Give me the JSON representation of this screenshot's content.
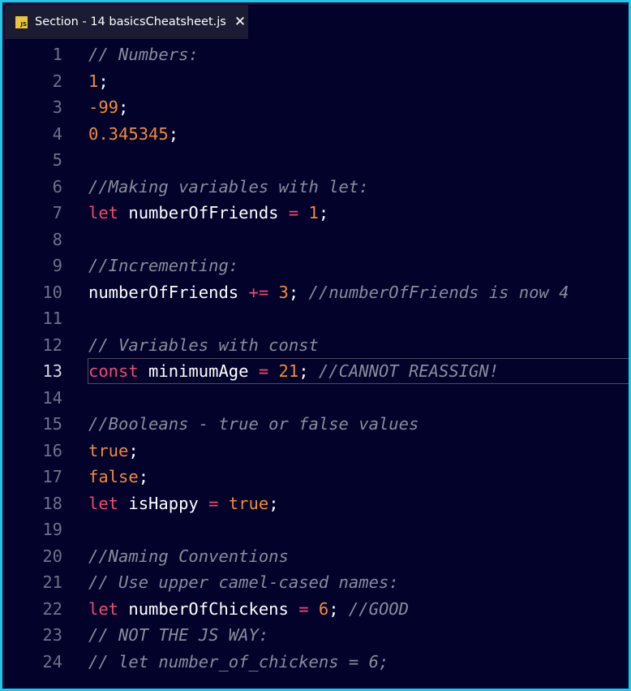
{
  "tab": {
    "icon_label": "JS",
    "title": "Section - 14 basicsCheatsheet.js",
    "close_glyph": "✕"
  },
  "current_line": 13,
  "colors": {
    "comment": "#8a8c9c",
    "number": "#f08a3c",
    "keyword": "#f24a6b",
    "plain": "#ffffff",
    "background": "#02022b",
    "border": "#1ec8ea"
  },
  "lines": [
    {
      "n": "1",
      "tokens": [
        {
          "t": "cm",
          "v": "// Numbers:"
        }
      ]
    },
    {
      "n": "2",
      "tokens": [
        {
          "t": "num",
          "v": "1"
        },
        {
          "t": "pl",
          "v": ";"
        }
      ]
    },
    {
      "n": "3",
      "tokens": [
        {
          "t": "num",
          "v": "-99"
        },
        {
          "t": "pl",
          "v": ";"
        }
      ]
    },
    {
      "n": "4",
      "tokens": [
        {
          "t": "num",
          "v": "0.345345"
        },
        {
          "t": "pl",
          "v": ";"
        }
      ]
    },
    {
      "n": "5",
      "tokens": []
    },
    {
      "n": "6",
      "tokens": [
        {
          "t": "cm",
          "v": "//Making variables with let:"
        }
      ]
    },
    {
      "n": "7",
      "tokens": [
        {
          "t": "kw",
          "v": "let"
        },
        {
          "t": "pl",
          "v": " numberOfFriends "
        },
        {
          "t": "op",
          "v": "="
        },
        {
          "t": "pl",
          "v": " "
        },
        {
          "t": "num",
          "v": "1"
        },
        {
          "t": "pl",
          "v": ";"
        }
      ]
    },
    {
      "n": "8",
      "tokens": []
    },
    {
      "n": "9",
      "tokens": [
        {
          "t": "cm",
          "v": "//Incrementing:"
        }
      ]
    },
    {
      "n": "10",
      "tokens": [
        {
          "t": "pl",
          "v": "numberOfFriends "
        },
        {
          "t": "op",
          "v": "+="
        },
        {
          "t": "pl",
          "v": " "
        },
        {
          "t": "num",
          "v": "3"
        },
        {
          "t": "pl",
          "v": "; "
        },
        {
          "t": "cm",
          "v": "//numberOfFriends is now 4"
        }
      ]
    },
    {
      "n": "11",
      "tokens": []
    },
    {
      "n": "12",
      "tokens": [
        {
          "t": "cm",
          "v": "// Variables with const"
        }
      ]
    },
    {
      "n": "13",
      "tokens": [
        {
          "t": "kw",
          "v": "const"
        },
        {
          "t": "pl",
          "v": " minimumAge "
        },
        {
          "t": "op",
          "v": "="
        },
        {
          "t": "pl",
          "v": " "
        },
        {
          "t": "num",
          "v": "21"
        },
        {
          "t": "pl",
          "v": "; "
        },
        {
          "t": "cm",
          "v": "//CANNOT REASSIGN!"
        }
      ]
    },
    {
      "n": "14",
      "tokens": []
    },
    {
      "n": "15",
      "tokens": [
        {
          "t": "cm",
          "v": "//Booleans - true or false values"
        }
      ]
    },
    {
      "n": "16",
      "tokens": [
        {
          "t": "num",
          "v": "true"
        },
        {
          "t": "pl",
          "v": ";"
        }
      ]
    },
    {
      "n": "17",
      "tokens": [
        {
          "t": "num",
          "v": "false"
        },
        {
          "t": "pl",
          "v": ";"
        }
      ]
    },
    {
      "n": "18",
      "tokens": [
        {
          "t": "kw",
          "v": "let"
        },
        {
          "t": "pl",
          "v": " isHappy "
        },
        {
          "t": "op",
          "v": "="
        },
        {
          "t": "pl",
          "v": " "
        },
        {
          "t": "num",
          "v": "true"
        },
        {
          "t": "pl",
          "v": ";"
        }
      ]
    },
    {
      "n": "19",
      "tokens": []
    },
    {
      "n": "20",
      "tokens": [
        {
          "t": "cm",
          "v": "//Naming Conventions"
        }
      ]
    },
    {
      "n": "21",
      "tokens": [
        {
          "t": "cm",
          "v": "// Use upper camel-cased names:"
        }
      ]
    },
    {
      "n": "22",
      "tokens": [
        {
          "t": "kw",
          "v": "let"
        },
        {
          "t": "pl",
          "v": " numberOfChickens "
        },
        {
          "t": "op",
          "v": "="
        },
        {
          "t": "pl",
          "v": " "
        },
        {
          "t": "num",
          "v": "6"
        },
        {
          "t": "pl",
          "v": "; "
        },
        {
          "t": "cm",
          "v": "//GOOD"
        }
      ]
    },
    {
      "n": "23",
      "tokens": [
        {
          "t": "cm",
          "v": "// NOT THE JS WAY:"
        }
      ]
    },
    {
      "n": "24",
      "tokens": [
        {
          "t": "cm",
          "v": "// let number_of_chickens = 6;"
        }
      ]
    }
  ]
}
